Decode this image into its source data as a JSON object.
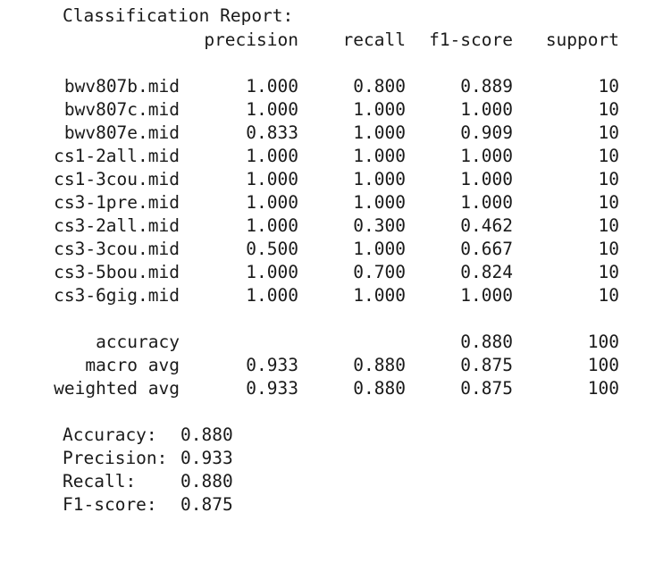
{
  "report": {
    "title": "Classification Report:",
    "headers": {
      "precision": "precision",
      "recall": "recall",
      "f1": "f1-score",
      "support": "support"
    },
    "rows": [
      {
        "label": "bwv807b.mid",
        "precision": "1.000",
        "recall": "0.800",
        "f1": "0.889",
        "support": "10"
      },
      {
        "label": "bwv807c.mid",
        "precision": "1.000",
        "recall": "1.000",
        "f1": "1.000",
        "support": "10"
      },
      {
        "label": "bwv807e.mid",
        "precision": "0.833",
        "recall": "1.000",
        "f1": "0.909",
        "support": "10"
      },
      {
        "label": "cs1-2all.mid",
        "precision": "1.000",
        "recall": "1.000",
        "f1": "1.000",
        "support": "10"
      },
      {
        "label": "cs1-3cou.mid",
        "precision": "1.000",
        "recall": "1.000",
        "f1": "1.000",
        "support": "10"
      },
      {
        "label": "cs3-1pre.mid",
        "precision": "1.000",
        "recall": "1.000",
        "f1": "1.000",
        "support": "10"
      },
      {
        "label": "cs3-2all.mid",
        "precision": "1.000",
        "recall": "0.300",
        "f1": "0.462",
        "support": "10"
      },
      {
        "label": "cs3-3cou.mid",
        "precision": "0.500",
        "recall": "1.000",
        "f1": "0.667",
        "support": "10"
      },
      {
        "label": "cs3-5bou.mid",
        "precision": "1.000",
        "recall": "0.700",
        "f1": "0.824",
        "support": "10"
      },
      {
        "label": "cs3-6gig.mid",
        "precision": "1.000",
        "recall": "1.000",
        "f1": "1.000",
        "support": "10"
      }
    ],
    "summary": [
      {
        "label": "accuracy",
        "precision": "",
        "recall": "",
        "f1": "0.880",
        "support": "100"
      },
      {
        "label": "macro avg",
        "precision": "0.933",
        "recall": "0.880",
        "f1": "0.875",
        "support": "100"
      },
      {
        "label": "weighted avg",
        "precision": "0.933",
        "recall": "0.880",
        "f1": "0.875",
        "support": "100"
      }
    ]
  },
  "metrics": [
    {
      "label": "Accuracy:",
      "value": "0.880"
    },
    {
      "label": "Precision:",
      "value": "0.933"
    },
    {
      "label": "Recall:",
      "value": "0.880"
    },
    {
      "label": "F1-score:",
      "value": "0.875"
    }
  ]
}
